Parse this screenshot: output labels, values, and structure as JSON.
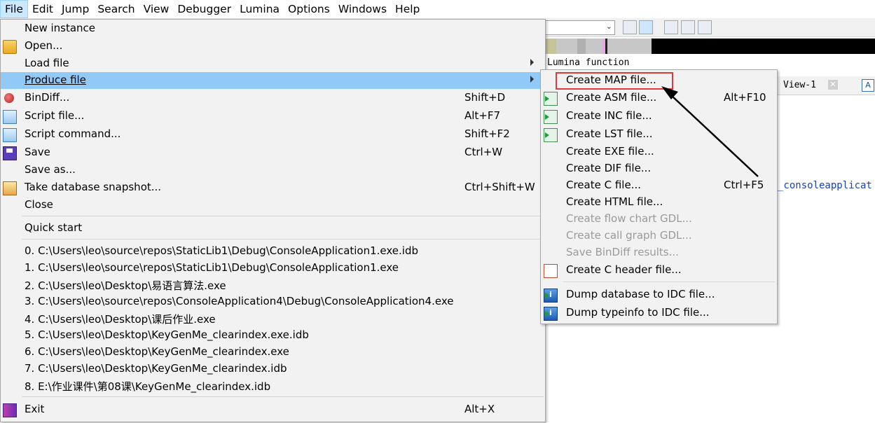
{
  "menubar": [
    "File",
    "Edit",
    "Jump",
    "Search",
    "View",
    "Debugger",
    "Lumina",
    "Options",
    "Windows",
    "Help"
  ],
  "background": {
    "hint_text": "Lumina function",
    "tab_label": "View-1",
    "tab_close": "✕",
    "tab_icon": "A",
    "code_text": "_consoleapplicat",
    "combo_arrow": "⌄"
  },
  "file_menu": {
    "items": [
      {
        "label": "New instance",
        "shortcut": "",
        "icon": ""
      },
      {
        "label": "Open...",
        "shortcut": "",
        "icon": "folder-icon"
      },
      {
        "label": "Load file",
        "shortcut": "",
        "icon": "",
        "submenu": true
      },
      {
        "label": "Produce file",
        "shortcut": "",
        "icon": "",
        "submenu": true,
        "highlighted": true
      },
      {
        "label": "BinDiff...",
        "shortcut": "Shift+D",
        "icon": "bindiff-icon"
      },
      {
        "label": "Script file...",
        "shortcut": "Alt+F7",
        "icon": "script-file-icon"
      },
      {
        "label": "Script command...",
        "shortcut": "Shift+F2",
        "icon": "script-command-icon"
      },
      {
        "label": "Save",
        "shortcut": "Ctrl+W",
        "icon": "save-icon"
      },
      {
        "label": "Save as...",
        "shortcut": "",
        "icon": ""
      },
      {
        "label": "Take database snapshot...",
        "shortcut": "Ctrl+Shift+W",
        "icon": "snapshot-icon"
      },
      {
        "label": "Close",
        "shortcut": "",
        "icon": ""
      }
    ],
    "quick_start": "Quick start",
    "recent_files": [
      "0. C:\\Users\\leo\\source\\repos\\StaticLib1\\Debug\\ConsoleApplication1.exe.idb",
      "1. C:\\Users\\leo\\source\\repos\\StaticLib1\\Debug\\ConsoleApplication1.exe",
      "2. C:\\Users\\leo\\Desktop\\易语言算法.exe",
      "3. C:\\Users\\leo\\source\\repos\\ConsoleApplication4\\Debug\\ConsoleApplication4.exe",
      "4. C:\\Users\\leo\\Desktop\\课后作业.exe",
      "5. C:\\Users\\leo\\Desktop\\KeyGenMe_clearindex.exe.idb",
      "6. C:\\Users\\leo\\Desktop\\KeyGenMe_clearindex.exe",
      "7. C:\\Users\\leo\\Desktop\\KeyGenMe_clearindex.idb",
      "8. E:\\作业课件\\第08课\\KeyGenMe_clearindex.idb"
    ],
    "exit": {
      "label": "Exit",
      "shortcut": "Alt+X"
    }
  },
  "produce_submenu": {
    "items": [
      {
        "label": "Create MAP file...",
        "shortcut": "",
        "enabled": true
      },
      {
        "label": "Create ASM file...",
        "shortcut": "Alt+F10",
        "enabled": true
      },
      {
        "label": "Create INC file...",
        "shortcut": "",
        "enabled": true
      },
      {
        "label": "Create LST file...",
        "shortcut": "",
        "enabled": true
      },
      {
        "label": "Create EXE file...",
        "shortcut": "",
        "enabled": true
      },
      {
        "label": "Create DIF file...",
        "shortcut": "",
        "enabled": true
      },
      {
        "label": "Create C file...",
        "shortcut": "Ctrl+F5",
        "enabled": true
      },
      {
        "label": "Create HTML file...",
        "shortcut": "",
        "enabled": true
      },
      {
        "label": "Create flow chart GDL...",
        "shortcut": "",
        "enabled": false
      },
      {
        "label": "Create call graph GDL...",
        "shortcut": "",
        "enabled": false
      },
      {
        "label": "Save BinDiff results...",
        "shortcut": "",
        "enabled": false
      },
      {
        "label": "Create C header file...",
        "shortcut": "",
        "enabled": true
      }
    ],
    "dump_items": [
      {
        "label": "Dump database to IDC file..."
      },
      {
        "label": "Dump typeinfo to IDC file..."
      }
    ]
  },
  "colors": {
    "menu_bg": "#f2f2f2",
    "highlight": "#91c9f7",
    "annotation_red": "#e03a3a",
    "disabled_text": "#9a9a9a"
  }
}
